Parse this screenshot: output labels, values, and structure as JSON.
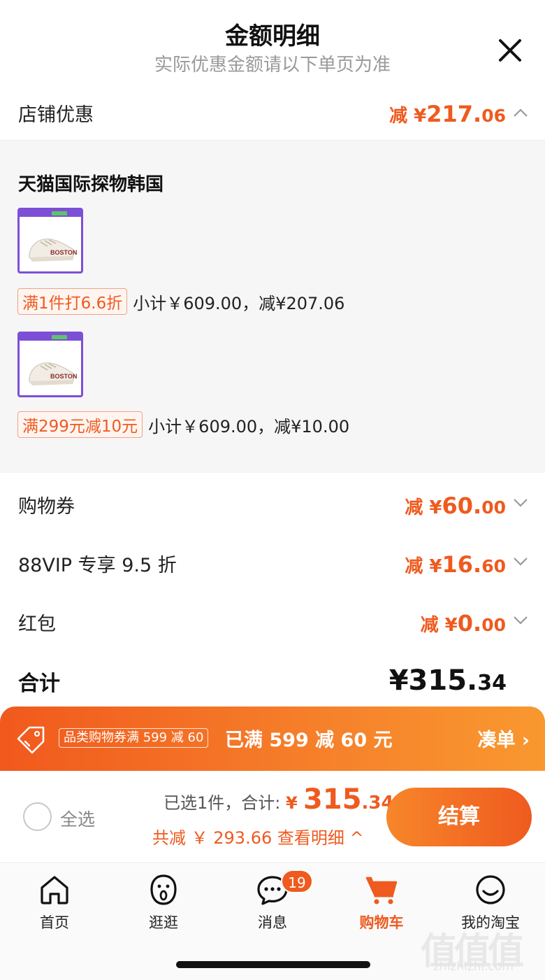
{
  "header": {
    "title": "金额明细",
    "subtitle": "实际优惠金额请以下单页为准"
  },
  "store_discount": {
    "label": "店铺优惠",
    "prefix": "减 ¥",
    "value_main": "217.",
    "value_decimal": "06",
    "expanded": true
  },
  "store": {
    "name": "天猫国际探物韩国",
    "items": [
      {
        "promo_tag": "满1件打6.6折",
        "promo_text": "小计￥609.00，减¥207.06"
      },
      {
        "promo_tag": "满299元减10元",
        "promo_text": "小计￥609.00，减¥10.00"
      }
    ]
  },
  "rows": [
    {
      "label": "购物券",
      "prefix": "减 ¥",
      "value_main": "60.",
      "value_decimal": "00"
    },
    {
      "label": "88VIP 专享 9.5 折",
      "prefix": "减 ¥",
      "value_main": "16.",
      "value_decimal": "60"
    },
    {
      "label": "红包",
      "prefix": "减 ¥",
      "value_main": "0.",
      "value_decimal": "00"
    }
  ],
  "total": {
    "label": "合计",
    "prefix": "¥",
    "value_main": "315.",
    "value_decimal": "34"
  },
  "coupon_bar": {
    "chip": "品类购物券满 599 减 60",
    "message": "已满 599 减 60 元",
    "action": "凑单",
    "action_arrow": "›"
  },
  "checkout": {
    "select_all": "全选",
    "selected_text": "已选1件，合计: ",
    "currency": "¥ ",
    "amount_main": "315",
    "amount_decimal": ".34",
    "saved_text": "共减 ￥ 293.66  查看明细",
    "saved_arrow": "^",
    "button": "结算"
  },
  "tabbar": {
    "items": [
      {
        "label": "首页",
        "icon": "home-icon",
        "active": false
      },
      {
        "label": "逛逛",
        "icon": "discover-icon",
        "active": false
      },
      {
        "label": "消息",
        "icon": "message-icon",
        "active": false,
        "badge": "19"
      },
      {
        "label": "购物车",
        "icon": "cart-icon",
        "active": true
      },
      {
        "label": "我的淘宝",
        "icon": "profile-icon",
        "active": false
      }
    ]
  },
  "watermark": {
    "glyphs": "值值值",
    "text": "zhizhizhi.com"
  },
  "colors": {
    "accent": "#ef5a1f",
    "purple_border": "#7d4fd6",
    "panel_bg": "#f6f6f6"
  }
}
